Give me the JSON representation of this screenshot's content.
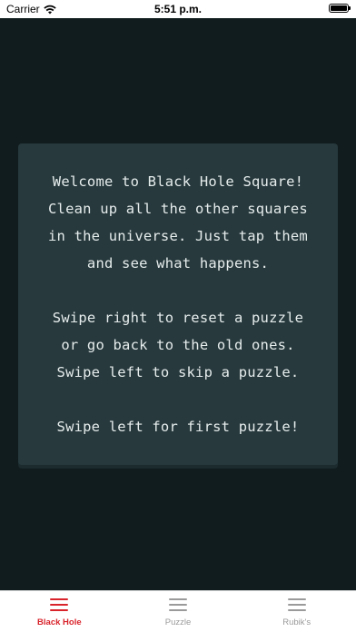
{
  "status_bar": {
    "carrier": "Carrier",
    "time": "5:51 p.m.",
    "wifi_icon": "wifi-icon",
    "battery_icon": "battery-icon"
  },
  "card": {
    "text": "Welcome to Black Hole Square!\nClean up all the other squares\nin the universe. Just tap them\nand see what happens.\n\nSwipe right to reset a puzzle\nor go back to the old ones.\nSwipe left to skip a puzzle.\n\nSwipe left for first puzzle!"
  },
  "tabs": [
    {
      "label": "Black Hole",
      "icon": "hamburger-icon",
      "active": true
    },
    {
      "label": "Puzzle",
      "icon": "hamburger-icon",
      "active": false
    },
    {
      "label": "Rubik's",
      "icon": "hamburger-icon",
      "active": false
    }
  ],
  "colors": {
    "background": "#101c1e",
    "card": "#27393d",
    "card_text": "#e6ecec",
    "accent": "#d9242c",
    "inactive_tab": "#9a9a9a"
  }
}
